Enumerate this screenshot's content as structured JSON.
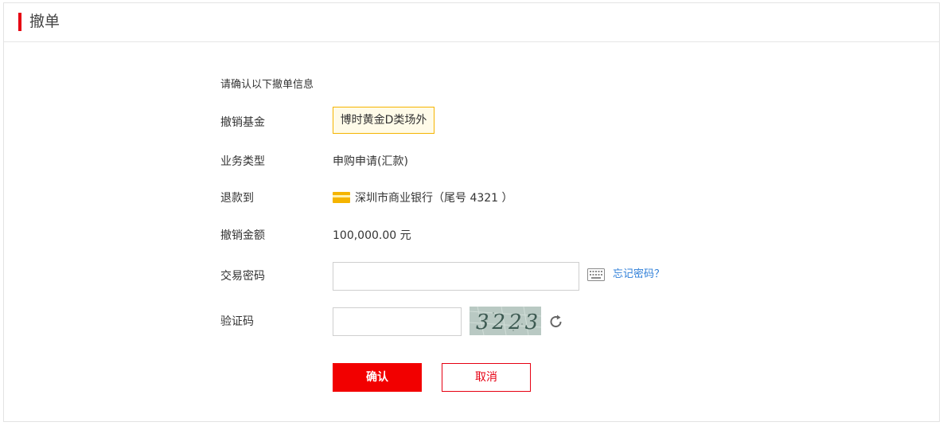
{
  "header": {
    "title": "撤单"
  },
  "form": {
    "intro": "请确认以下撤单信息",
    "fund": {
      "label": "撤销基金",
      "value": "博时黄金D类场外"
    },
    "business_type": {
      "label": "业务类型",
      "value": "申购申请(汇款)"
    },
    "refund_to": {
      "label": "退款到",
      "value": "深圳市商业银行（尾号 4321 ）",
      "icon": "bank-card-icon"
    },
    "amount": {
      "label": "撤销金额",
      "value": "100,000.00 元"
    },
    "password": {
      "label": "交易密码",
      "value": "",
      "placeholder": "",
      "keyboard_icon": "keyboard-icon",
      "forgot_label": "忘记密码？"
    },
    "captcha": {
      "label": "验证码",
      "value": "",
      "placeholder": "",
      "image_text": "3223",
      "refresh_icon": "refresh-icon"
    }
  },
  "buttons": {
    "confirm_label": "确认",
    "cancel_label": "取消"
  },
  "colors": {
    "accent_red": "#e60012",
    "confirm_bg": "#f20000",
    "fund_border": "#f5b400",
    "fund_bg": "#fffbe8",
    "link_blue": "#2f7fd8"
  }
}
